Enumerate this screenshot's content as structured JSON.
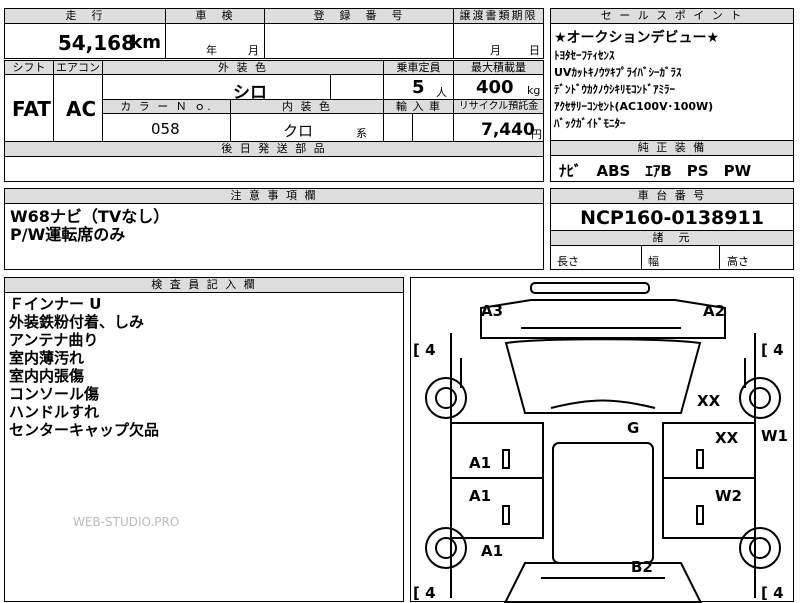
{
  "header": {
    "mileage_label": "走　行",
    "inspection_label": "車　検",
    "registration_label": "登　録　番　号",
    "transfer_label": "譲渡書類期限",
    "sales_label": "セ ー ル ス ポ イ ン ト"
  },
  "mileage": {
    "value": "54,168",
    "unit": "km"
  },
  "inspection": {
    "year_unit": "年",
    "month_unit": "月"
  },
  "transfer": {
    "month_unit": "月",
    "day_unit": "日"
  },
  "row2": {
    "shift_label": "シフト",
    "aircon_label": "エアコン",
    "ext_color_label": "外 装 色",
    "capacity_label": "乗車定員",
    "max_load_label": "最大積載量",
    "shift": "FAT",
    "aircon": "AC",
    "ext_color": "シロ",
    "capacity": "5",
    "capacity_unit": "人",
    "max_load": "400",
    "max_load_unit": "kg",
    "color_no_label": "カ ラ ー Ｎ ｏ.",
    "int_color_label": "内 装 色",
    "import_label": "輸 入 車",
    "recycle_label": "リサイクル預託金",
    "color_no": "058",
    "int_color": "クロ",
    "int_color_suffix": "系",
    "recycle": "7,440",
    "recycle_unit": "円",
    "shipping_label": "後 日 発 送 部 品"
  },
  "sales_points": [
    "★オークションデビュー★",
    "ﾄﾖﾀｾｰﾌﾃｨｾﾝｽ",
    "UVｶｯﾄｷﾉｳﾂｷﾌﾟﾗｲﾊﾞｼｰｶﾞﾗｽ",
    "ﾃﾞﾝﾄﾞｳｶｸﾉｳｼｷﾘﾓｺﾝﾄﾞｱﾐﾗｰ",
    "ｱｸｾｻﾘｰｺﾝｾﾝﾄ(AC100V･100W)",
    "ﾊﾞｯｸｶﾞｲﾄﾞﾓﾆﾀｰ"
  ],
  "equipment": {
    "label": "純 正 装 備",
    "value": "ﾅﾋﾞ　ABS　ｴｱB　PS　PW"
  },
  "caution": {
    "label": "注 意 事 項 欄",
    "lines": [
      "W68ナビ（TVなし）",
      "P/W運転席のみ"
    ]
  },
  "chassis": {
    "label": "車 台 番 号",
    "value": "NCP160-0138911",
    "specs_label": "諸　元",
    "length_label": "長さ",
    "width_label": "幅",
    "height_label": "高さ"
  },
  "inspector": {
    "label": "検 査 員 記 入 欄",
    "lines": [
      "Ｆインナー U",
      "外装鉄粉付着、しみ",
      "アンテナ曲り",
      "室内薄汚れ",
      "室内内張傷",
      "コンソール傷",
      "ハンドルすれ",
      "センターキャップ欠品"
    ],
    "watermark": "WEB-STUDIO.PRO"
  },
  "diagram": {
    "marks": [
      "A3",
      "A2",
      "XX",
      "G",
      "XX",
      "W1",
      "A1",
      "A1",
      "W2",
      "A1",
      "B2"
    ],
    "tire_marks": [
      "[ 4",
      "[ 4",
      "[ 4",
      "[ 4"
    ]
  }
}
